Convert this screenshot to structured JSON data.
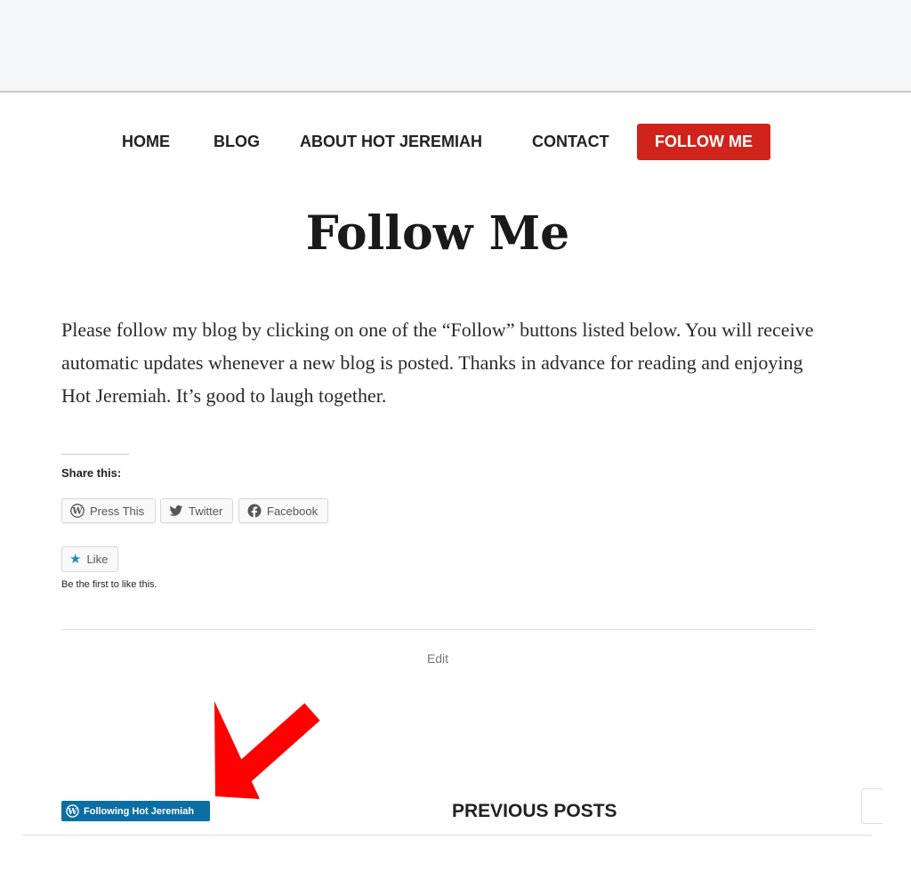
{
  "nav": {
    "items": [
      {
        "label": "HOME"
      },
      {
        "label": "BLOG"
      },
      {
        "label": "ABOUT HOT JEREMIAH"
      },
      {
        "label": "CONTACT"
      },
      {
        "label": "FOLLOW ME"
      }
    ]
  },
  "page": {
    "title": "Follow Me",
    "intro": "Please follow my blog by clicking on one of the “Follow” buttons listed below. You will receive automatic updates whenever a new blog is posted. Thanks in advance for reading and enjoying Hot Jeremiah. It’s good to laugh together."
  },
  "share": {
    "title": "Share this:",
    "buttons": [
      {
        "label": "Press This",
        "icon": "wordpress-icon"
      },
      {
        "label": "Twitter",
        "icon": "twitter-icon"
      },
      {
        "label": "Facebook",
        "icon": "facebook-icon"
      }
    ]
  },
  "like": {
    "label": "Like",
    "note": "Be the first to like this."
  },
  "edit_label": "Edit",
  "follow_widget": {
    "label": "Following Hot Jeremiah",
    "icon": "wordpress-icon"
  },
  "previous_posts_label": "PREVIOUS POSTS",
  "colors": {
    "accent": "#d0241a",
    "follow_widget_bg": "#0b6fa4",
    "annotation_arrow": "#ff0000"
  }
}
